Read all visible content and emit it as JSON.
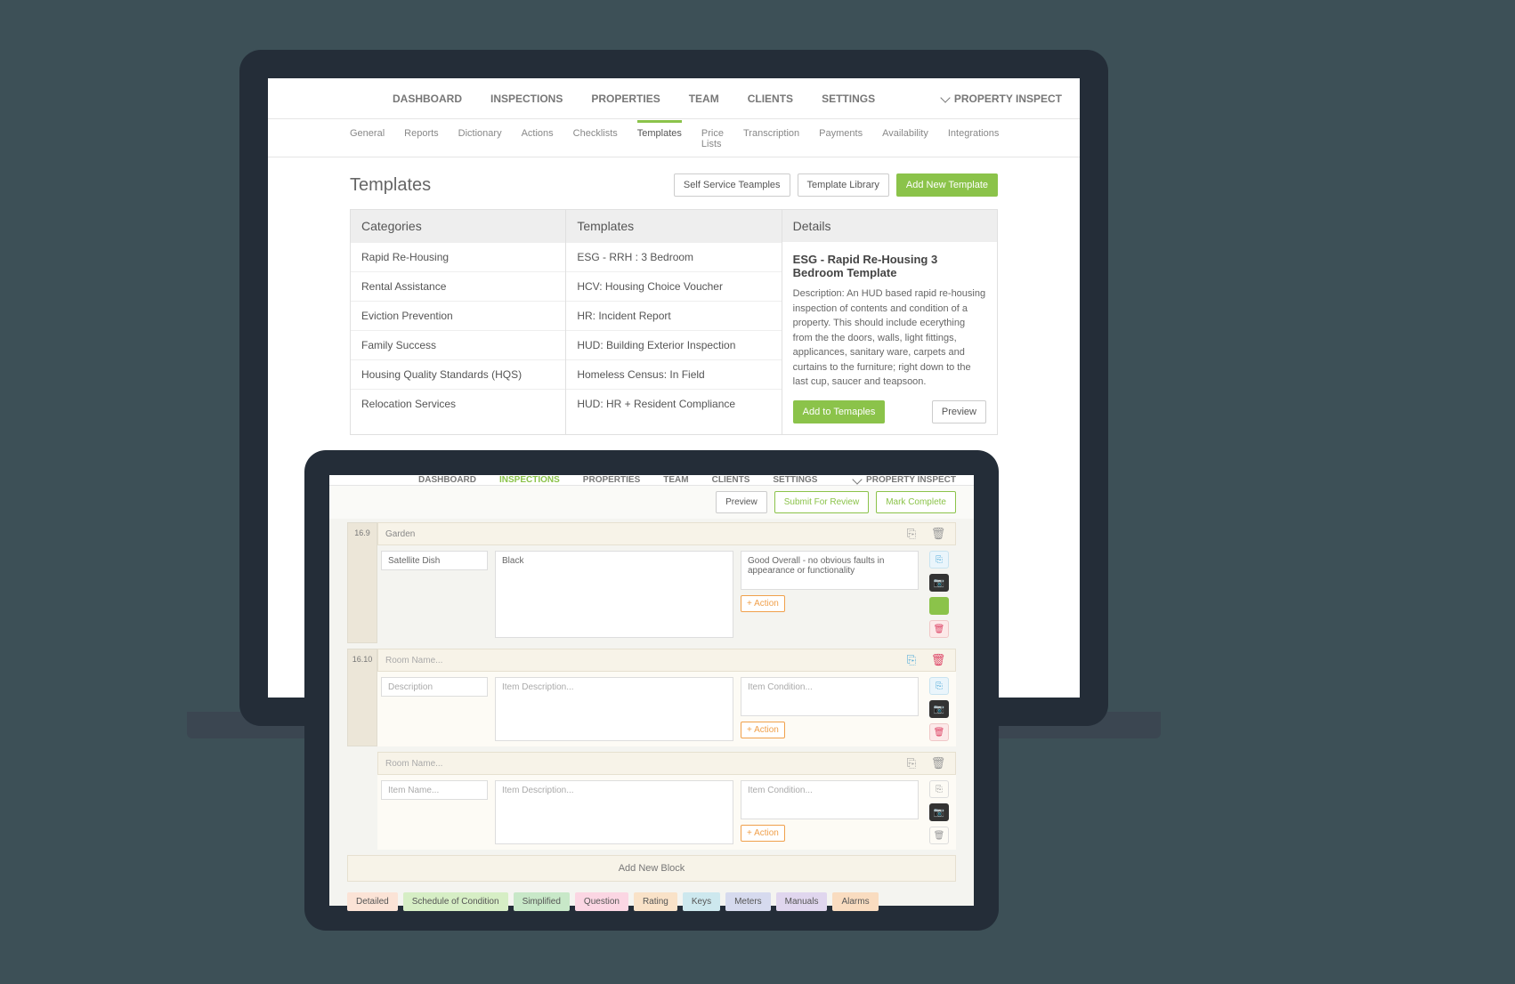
{
  "brand": "PROPERTY INSPECT",
  "nav": [
    "DASHBOARD",
    "INSPECTIONS",
    "PROPERTIES",
    "TEAM",
    "CLIENTS",
    "SETTINGS"
  ],
  "submenu": [
    "General",
    "Reports",
    "Dictionary",
    "Actions",
    "Checklists",
    "Templates",
    "Price Lists",
    "Transcription",
    "Payments",
    "Availability",
    "Integrations"
  ],
  "submenu_active": "Templates",
  "templates": {
    "title": "Templates",
    "buttons": {
      "self": "Self Service Teamples",
      "lib": "Template Library",
      "add": "Add New Template"
    },
    "colheads": {
      "cat": "Categories",
      "tmpl": "Templates",
      "det": "Details"
    },
    "categories": [
      "Rapid Re-Housing",
      "Rental Assistance",
      "Eviction Prevention",
      "Family Success",
      "Housing Quality Standards (HQS)",
      "Relocation Services"
    ],
    "tmpl_list": [
      "ESG - RRH : 3 Bedroom",
      "HCV: Housing Choice Voucher",
      "HR: Incident Report",
      "HUD: Building Exterior Inspection",
      "Homeless Census: In Field",
      "HUD: HR + Resident Compliance"
    ],
    "detail": {
      "title": "ESG - Rapid Re-Housing 3 Bedroom Template",
      "desc": "Description: An HUD based rapid re-housing inspection of contents and condition of a property. This should include ecerything from the the doors, walls, light fittings, applicances, sanitary ware, carpets and curtains to the furniture; right down to the last cup, saucer and teapsoon.",
      "add": "Add to Temaples",
      "preview": "Preview"
    }
  },
  "front": {
    "nav_active": "INSPECTIONS",
    "toolbar": {
      "preview": "Preview",
      "submit": "Submit For Review",
      "complete": "Mark Complete"
    },
    "blocks": [
      {
        "num": "16.9",
        "room": "Garden",
        "item": "Satellite Dish",
        "desc": "Black",
        "cond": "Good Overall - no obvious faults in appearance or functionality",
        "action": "+ Action",
        "filled": true,
        "greensq": true,
        "toprow_icons": "grey"
      },
      {
        "num": "16.10",
        "room": "Room Name...",
        "item": "Description",
        "desc": "Item Description...",
        "cond": "Item Condition...",
        "action": "+ Action",
        "filled": false,
        "toprow_icons": "color"
      },
      {
        "num": "",
        "room": "Room Name...",
        "item": "Item Name...",
        "desc": "Item Description...",
        "cond": "Item Condition...",
        "action": "+ Action",
        "filled": false,
        "toprow_icons": "grey",
        "allgrey": true
      }
    ],
    "addblock": "Add New Block",
    "chips": [
      "Detailed",
      "Schedule of Condition",
      "Simplified",
      "Question",
      "Rating",
      "Keys",
      "Meters",
      "Manuals",
      "Alarms"
    ]
  }
}
